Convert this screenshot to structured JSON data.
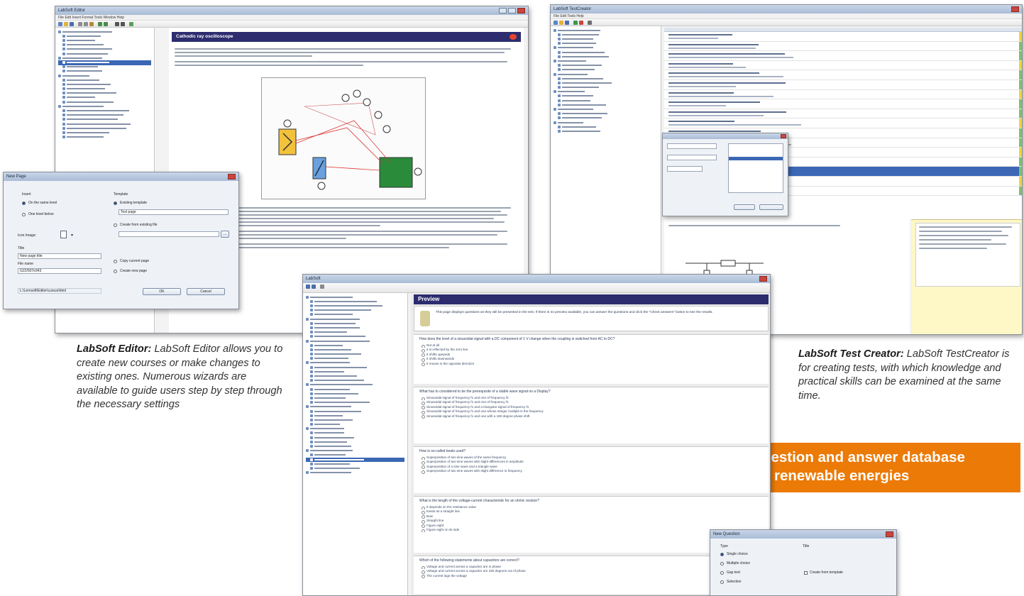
{
  "captions": {
    "editor_bold": "LabSoft Editor:",
    "editor_text": " LabSoft Editor allows you to create new courses or make changes to existing ones. Numerous wizards are available to guide users step by step through the necessary settings",
    "test_creator_bold": "LabSoft Test Creator:",
    "test_creator_text": " LabSoft TestCreator is for creating tests, with which knowledge and practical skills can be examined at the same time."
  },
  "banner": {
    "line1": "Question and answer database",
    "line2": "for renewable energies"
  },
  "editor_window": {
    "title": "LabSoft Editor",
    "page_title": "Cathodic ray oscilloscope",
    "menu": "File  Edit  Insert  Format  Tools  Window  Help"
  },
  "new_page_dialog": {
    "title": "New Page",
    "insert_label": "Insert",
    "insert_options": [
      "On the same level",
      "One level below"
    ],
    "template_label": "Template",
    "template_options": [
      "Existing template",
      "Create from existing file",
      "Copy current page",
      "Create new page"
    ],
    "template_value": "Text page",
    "icon_label": "Icon Image:",
    "title_label": "Title",
    "title_value": "New page title",
    "filename_label": "File name",
    "filename_value": "G22/507e943",
    "path_value": "L:\\Lernsoft\\Editor\\cursus\\html",
    "ok": "OK",
    "cancel": "Cancel"
  },
  "test_creator_window": {
    "title": "LabSoft TestCreator",
    "menu": "File  Edit  Tools  Help"
  },
  "preview_window": {
    "title": "LabSoft",
    "heading": "Preview",
    "intro": "This page displays questions as they will be presented in the test. If there is no preview available, you can answer the questions and click the \"Check answers\" button to see the results.",
    "questions": [
      {
        "q": "How does the level of a sinusoidal signal with a DC component of 1 V change when the coupling is switched from AC to DC?",
        "answers": [
          "Not at all",
          "It is reflected by the zero line",
          "It shifts upwards",
          "It shifts downwards",
          "It moves in the opposite direction"
        ]
      },
      {
        "q": "What has to considered to be the prerequisite of a stable wave signal on a Display?",
        "answers": [
          "Sinusoidal signal of frequency f1 and one of frequency f2",
          "Sinusoidal signal of frequency f1 and one of frequency f1",
          "Sinusoidal signal of frequency f1 and a triangular signal of frequency f1",
          "Sinusoidal signal of frequency f1 and one whose integer multiple is the frequency",
          "Sinusoidal signal of frequency f1 and one with a 180 degree phase shift"
        ]
      },
      {
        "q": "How is so-called beats used?",
        "answers": [
          "Superposition of two sine waves of the same frequency",
          "Superposition of two sine waves with slight differences in amplitude",
          "Superposition of a sine wave and a triangle wave",
          "Superposition of two sine waves with slight difference in frequency"
        ]
      },
      {
        "q": "What is the length of the voltage-current characteristic for an ohmic resistor?",
        "answers": [
          "It depends on the resistance value",
          "Exists as a straight line",
          "Bow",
          "Straight line",
          "Figure eight",
          "Figure eight on its side"
        ]
      },
      {
        "q": "Which of the following statements about capacitors are correct?",
        "answers": [
          "Voltage and current across a capacitor are in phase",
          "Voltage and current across a capacitor are 180 degrees out of phase",
          "The current lags the voltage"
        ]
      }
    ]
  },
  "new_question_dialog": {
    "title": "New Question",
    "type_label": "Type",
    "title_label": "Title",
    "types": [
      "Single choice",
      "Multiple choice",
      "Gap text",
      "Selection"
    ],
    "create_label": "Create from template"
  }
}
